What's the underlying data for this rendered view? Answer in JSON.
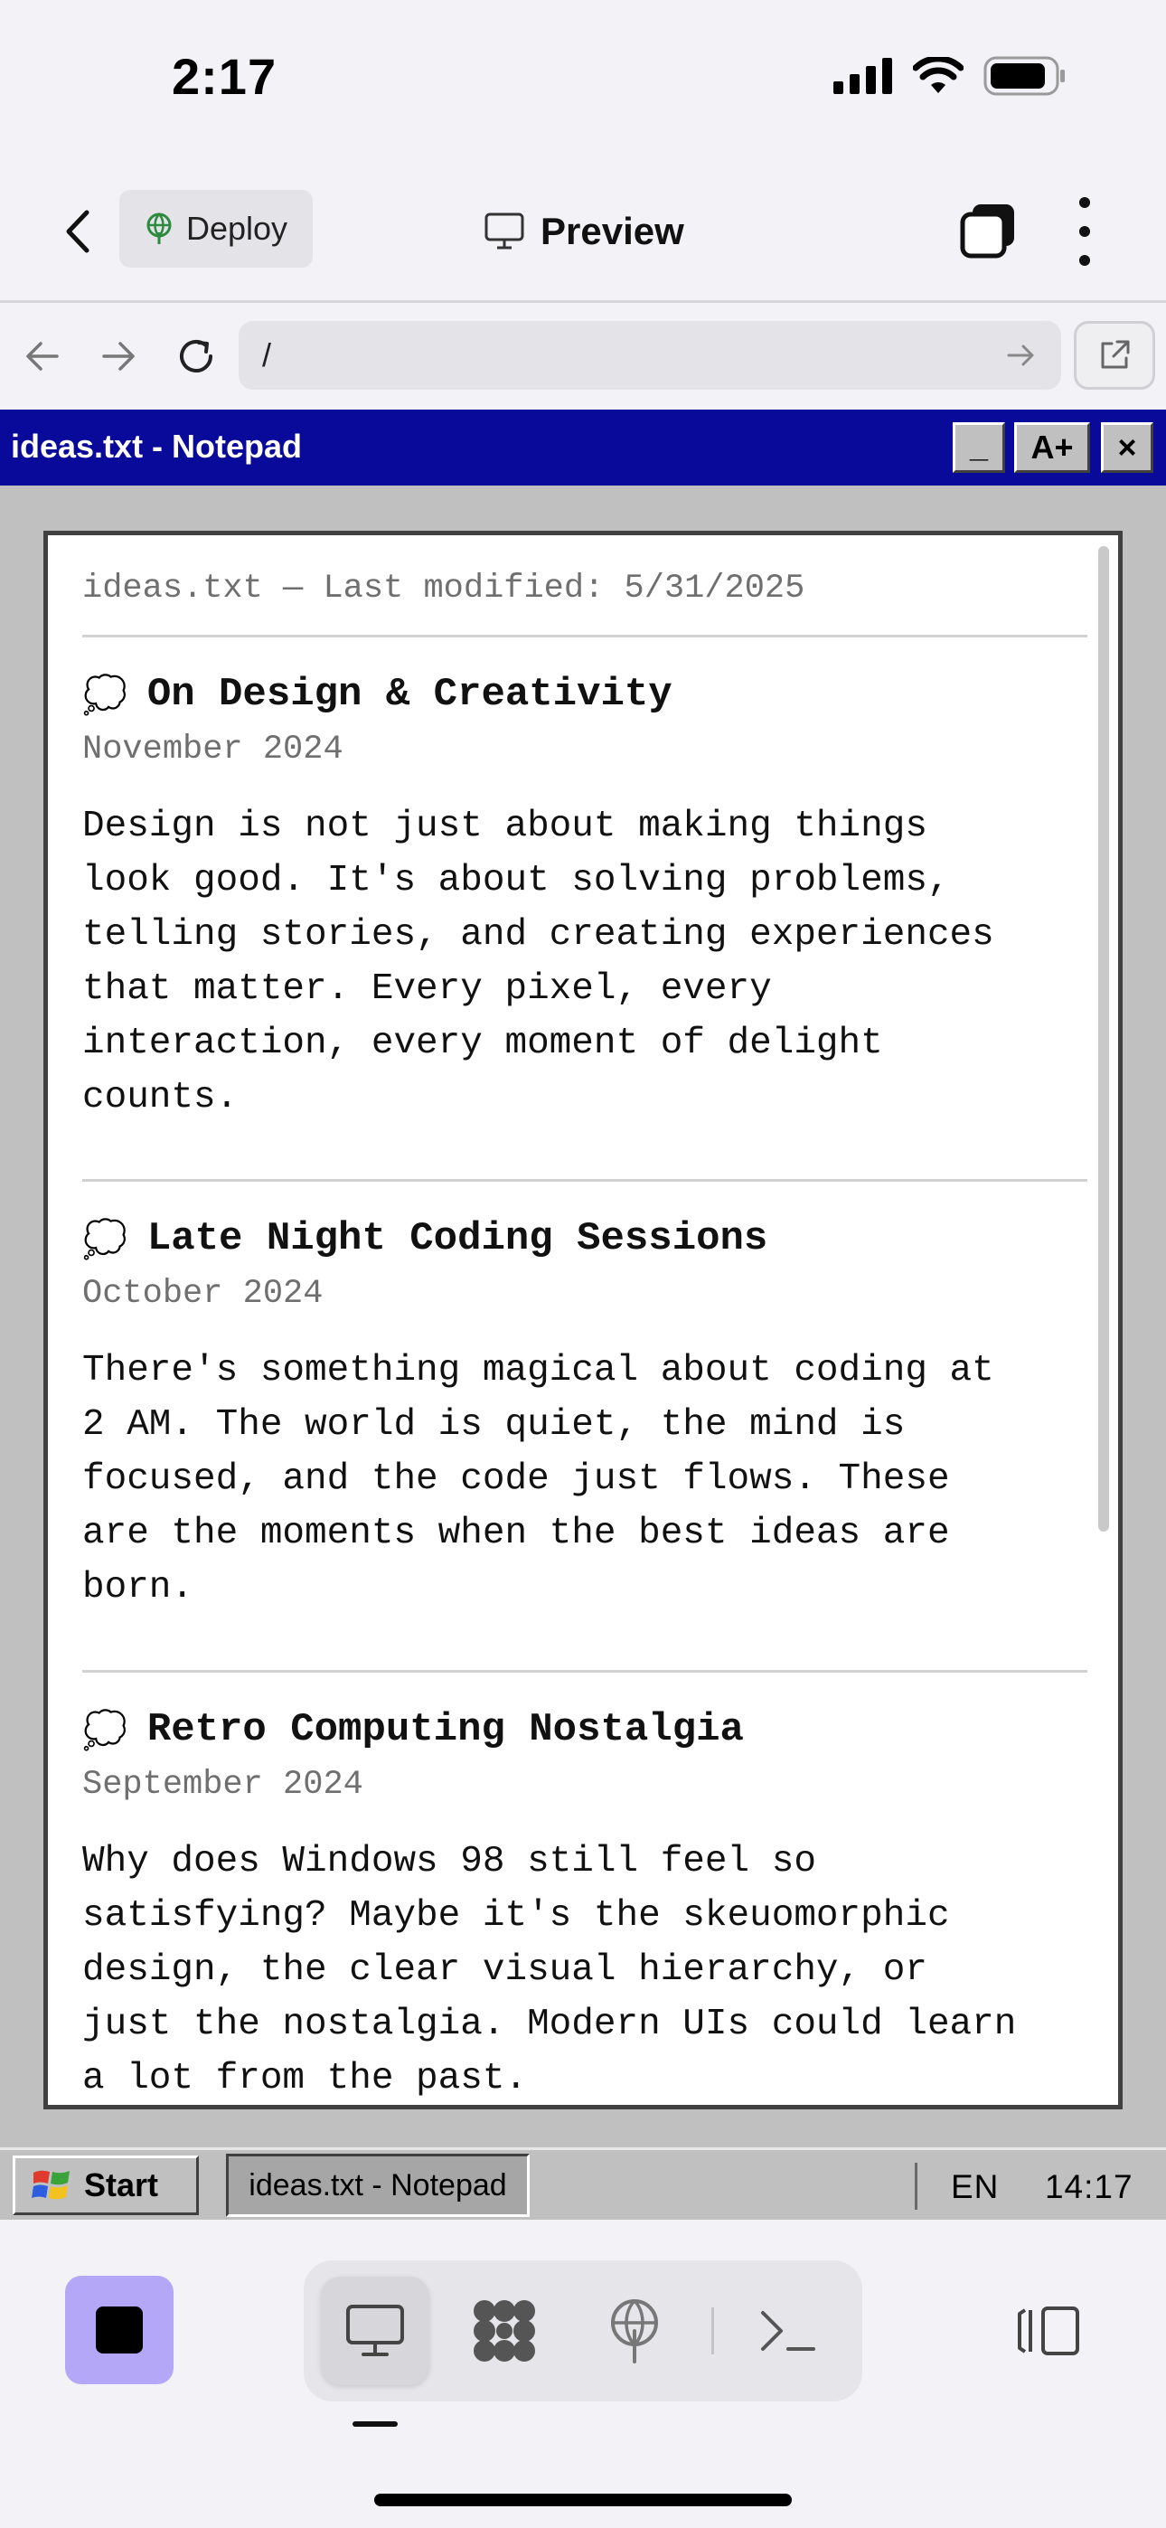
{
  "status_bar": {
    "time": "2:17"
  },
  "header": {
    "deploy_label": "Deploy",
    "title": "Preview"
  },
  "browser": {
    "url": "/"
  },
  "window": {
    "title": "ideas.txt - Notepad",
    "minimize_label": "_",
    "font_size_label": "A+",
    "close_label": "×"
  },
  "document": {
    "header": "ideas.txt — Last modified: 5/31/2025",
    "entries": [
      {
        "icon": "💭",
        "title": "On Design & Creativity",
        "date": "November 2024",
        "body": "Design is not just about making things\nlook good. It's about solving problems,\ntelling stories, and creating experiences\nthat matter. Every pixel, every\ninteraction, every moment of delight\ncounts."
      },
      {
        "icon": "💭",
        "title": "Late Night Coding Sessions",
        "date": "October 2024",
        "body": "There's something magical about coding at\n2 AM. The world is quiet, the mind is\nfocused, and the code just flows. These\nare the moments when the best ideas are\nborn."
      },
      {
        "icon": "💭",
        "title": "Retro Computing Nostalgia",
        "date": "September 2024",
        "body": "Why does Windows 98 still feel so\nsatisfying? Maybe it's the skeuomorphic\ndesign, the clear visual hierarchy, or\njust the nostalgia. Modern UIs could learn\na lot from the past."
      }
    ]
  },
  "taskbar": {
    "start_label": "Start",
    "task_label": "ideas.txt - Notepad",
    "language": "EN",
    "clock": "14:17"
  },
  "dock": {
    "tabs": [
      "desktop-icon",
      "apps-icon",
      "deploy-icon",
      "terminal-icon"
    ],
    "active_tab": "desktop-icon"
  },
  "colors": {
    "win_titlebar": "#0a0a9a",
    "win_face": "#c0c0c0",
    "stop_button": "#b4a7f7"
  }
}
